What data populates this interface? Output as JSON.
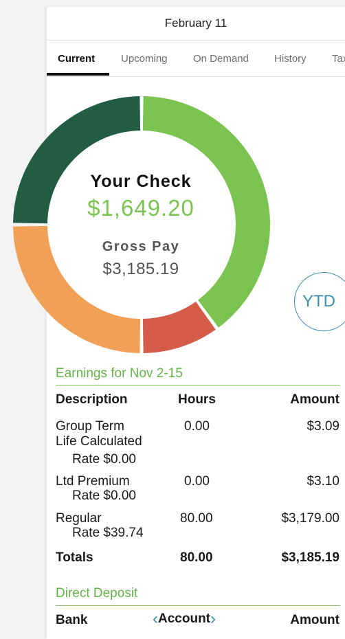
{
  "header": {
    "date": "February 11"
  },
  "tabs": [
    {
      "label": "Current",
      "active": true
    },
    {
      "label": "Upcoming",
      "active": false
    },
    {
      "label": "On Demand",
      "active": false
    },
    {
      "label": "History",
      "active": false
    },
    {
      "label": "Taxes",
      "active": false
    }
  ],
  "summary": {
    "your_check_label": "Your Check",
    "net_amount": "$1,649.20",
    "gross_label": "Gross Pay",
    "gross_amount": "$3,185.19",
    "ytd_label": "YTD"
  },
  "donut": {
    "segments": [
      {
        "name": "net-pay-segment",
        "fraction": 0.4,
        "color": "#7bc452"
      },
      {
        "name": "red-segment",
        "fraction": 0.1,
        "color": "#d55c48"
      },
      {
        "name": "orange-segment",
        "fraction": 0.25,
        "color": "#f0a057"
      },
      {
        "name": "dark-green-segment",
        "fraction": 0.25,
        "color": "#235c45"
      }
    ]
  },
  "earnings": {
    "title": "Earnings for Nov 2-15",
    "columns": [
      "Description",
      "Hours",
      "Amount"
    ],
    "rows": [
      {
        "description": "Group Term\nLife Calculated",
        "rate": "Rate $0.00",
        "hours": "0.00",
        "amount": "$3.09"
      },
      {
        "description": "Ltd Premium",
        "rate": "Rate $0.00",
        "hours": "0.00",
        "amount": "$3.10"
      },
      {
        "description": "Regular",
        "rate": "Rate $39.74",
        "hours": "80.00",
        "amount": "$3,179.00"
      }
    ],
    "totals": {
      "label": "Totals",
      "hours": "80.00",
      "amount": "$3,185.19"
    }
  },
  "direct_deposit": {
    "title": "Direct Deposit",
    "columns": {
      "bank": "Bank",
      "account": "Account",
      "amount": "Amount"
    }
  },
  "colors": {
    "accent_green": "#7bc452",
    "accent_teal": "#3d8fa8"
  }
}
